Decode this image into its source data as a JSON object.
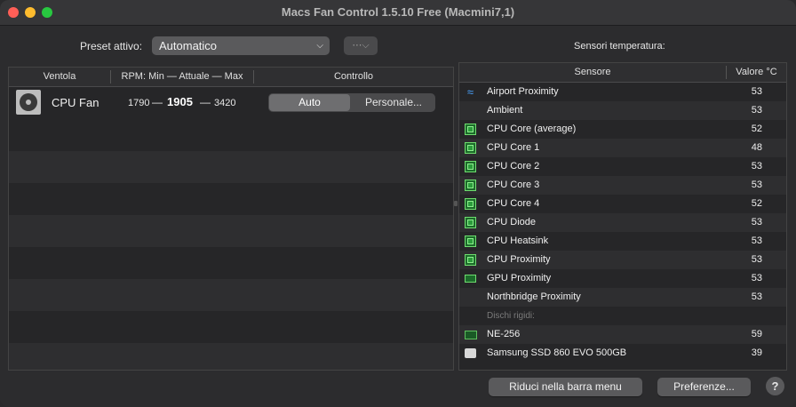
{
  "window": {
    "title": "Macs Fan Control 1.5.10 Free (Macmini7,1)"
  },
  "preset": {
    "label": "Preset attivo:",
    "selected": "Automatico",
    "menu_icon": "ellipsis-circle-icon"
  },
  "fans": {
    "columns": [
      "Ventola",
      "RPM: Min — Attuale — Max",
      "Controllo"
    ],
    "items": [
      {
        "name": "CPU Fan",
        "icon": "fan-icon",
        "rpm_min": "1790",
        "rpm_current": "1905",
        "rpm_max": "3420",
        "dash": "—",
        "control_options": [
          "Auto",
          "Personale..."
        ],
        "control_selected": "Auto"
      }
    ]
  },
  "sensors": {
    "title": "Sensori temperatura:",
    "columns": [
      "Sensore",
      "Valore °C"
    ],
    "items": [
      {
        "name": "Airport Proximity",
        "value": "53",
        "icon": "wifi-icon"
      },
      {
        "name": "Ambient",
        "value": "53",
        "icon": ""
      },
      {
        "name": "CPU Core (average)",
        "value": "52",
        "icon": "cpu-chip-icon"
      },
      {
        "name": "CPU Core 1",
        "value": "48",
        "icon": "cpu-chip-icon"
      },
      {
        "name": "CPU Core 2",
        "value": "53",
        "icon": "cpu-chip-icon"
      },
      {
        "name": "CPU Core 3",
        "value": "53",
        "icon": "cpu-chip-icon"
      },
      {
        "name": "CPU Core 4",
        "value": "52",
        "icon": "cpu-chip-icon"
      },
      {
        "name": "CPU Diode",
        "value": "53",
        "icon": "cpu-chip-icon"
      },
      {
        "name": "CPU Heatsink",
        "value": "53",
        "icon": "cpu-chip-icon"
      },
      {
        "name": "CPU Proximity",
        "value": "53",
        "icon": "cpu-chip-icon"
      },
      {
        "name": "GPU Proximity",
        "value": "53",
        "icon": "gpu-card-icon"
      },
      {
        "name": "Northbridge Proximity",
        "value": "53",
        "icon": ""
      }
    ],
    "group_label": "Dischi rigidi:",
    "disks": [
      {
        "name": "NE-256",
        "value": "59",
        "icon": "ssd-icon"
      },
      {
        "name": "Samsung SSD 860 EVO 500GB",
        "value": "39",
        "icon": "disk-icon"
      }
    ]
  },
  "buttons": {
    "reduce": "Riduci nella barra menu",
    "prefs": "Preferenze...",
    "help": "?"
  },
  "colors": {
    "background": "#2c2c2e",
    "close": "#ff5f57",
    "minimize": "#febc2e",
    "maximize": "#28c840",
    "chip_green": "#6fdc6f",
    "wifi_blue": "#4aa3ff"
  }
}
